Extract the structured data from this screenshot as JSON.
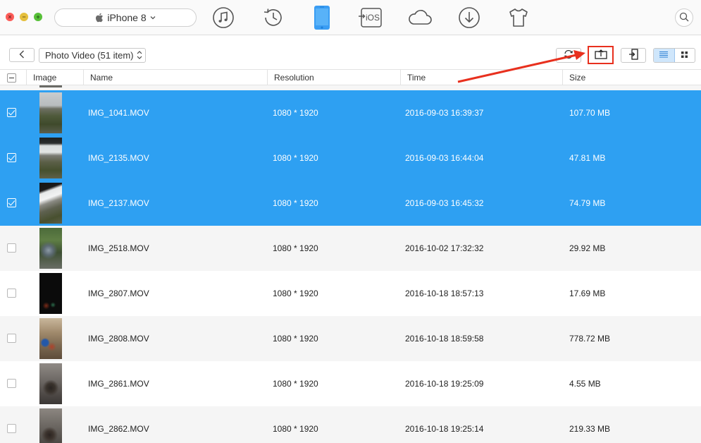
{
  "window": {
    "device_name": "iPhone 8"
  },
  "toolbar": {
    "icons": [
      "music-icon",
      "history-icon",
      "phone-icon",
      "to-ios-icon",
      "cloud-icon",
      "download-icon",
      "tshirt-icon"
    ],
    "to_ios_text": "iOS",
    "accent_color": "#2ea0f2"
  },
  "subbar": {
    "category": "Photo Video (51 item)",
    "buttons": [
      "refresh",
      "to-computer",
      "to-device",
      "list-view",
      "grid-view"
    ],
    "highlight_color": "#e8301e"
  },
  "table": {
    "columns": {
      "image": "Image",
      "name": "Name",
      "resolution": "Resolution",
      "time": "Time",
      "size": "Size"
    },
    "rows": [
      {
        "name": "IMG_1041.MOV",
        "resolution": "1080 * 1920",
        "time": "2016-09-03 16:39:37",
        "size": "107.70 MB",
        "selected": true
      },
      {
        "name": "IMG_2135.MOV",
        "resolution": "1080 * 1920",
        "time": "2016-09-03 16:44:04",
        "size": "47.81 MB",
        "selected": true
      },
      {
        "name": "IMG_2137.MOV",
        "resolution": "1080 * 1920",
        "time": "2016-09-03 16:45:32",
        "size": "74.79 MB",
        "selected": true
      },
      {
        "name": "IMG_2518.MOV",
        "resolution": "1080 * 1920",
        "time": "2016-10-02 17:32:32",
        "size": "29.92 MB",
        "selected": false
      },
      {
        "name": "IMG_2807.MOV",
        "resolution": "1080 * 1920",
        "time": "2016-10-18 18:57:13",
        "size": "17.69 MB",
        "selected": false
      },
      {
        "name": "IMG_2808.MOV",
        "resolution": "1080 * 1920",
        "time": "2016-10-18 18:59:58",
        "size": "778.72 MB",
        "selected": false
      },
      {
        "name": "IMG_2861.MOV",
        "resolution": "1080 * 1920",
        "time": "2016-10-18 19:25:09",
        "size": "4.55 MB",
        "selected": false
      },
      {
        "name": "IMG_2862.MOV",
        "resolution": "1080 * 1920",
        "time": "2016-10-18 19:25:14",
        "size": "219.33 MB",
        "selected": false
      }
    ]
  },
  "annotation": {
    "arrow_color": "#e8301e",
    "target": "to-computer-button"
  }
}
